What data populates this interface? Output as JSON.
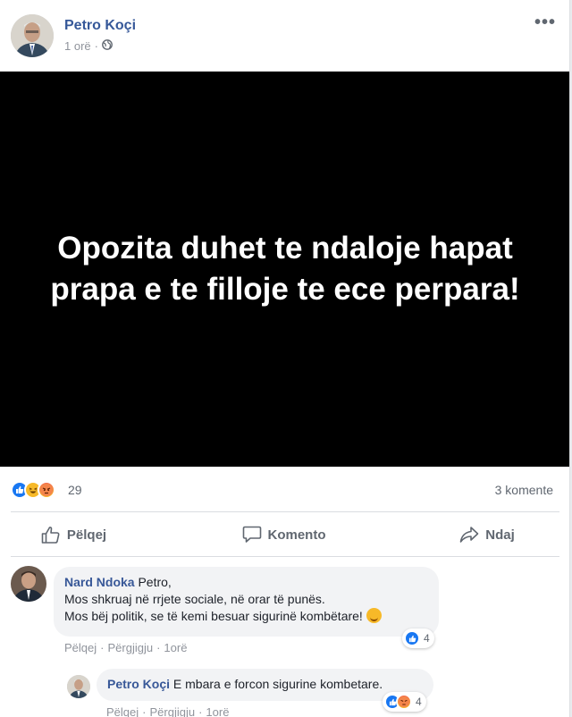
{
  "post": {
    "author": "Petro Koçi",
    "time": "1 orë",
    "separator": "·",
    "more_icon": "more-horizontal-icon",
    "privacy_icon": "globe-icon",
    "image_text": "Opozita duhet te ndaloje hapat prapa e te filloje te ece perpara!"
  },
  "stats": {
    "reactions": [
      "like",
      "haha",
      "angry"
    ],
    "reaction_count": "29",
    "comment_count": "3 komente"
  },
  "actions": [
    {
      "label": "Pëlqej",
      "icon": "thumbs-up-icon"
    },
    {
      "label": "Komento",
      "icon": "comment-icon"
    },
    {
      "label": "Ndaj",
      "icon": "share-icon"
    }
  ],
  "comments": [
    {
      "author": "Nard Ndoka",
      "lines": [
        "Petro,",
        "Mos shkruaj në rrjete sociale, në orar të punës.",
        "Mos bëj politik, se të kemi besuar sigurinë kombëtare!"
      ],
      "like": "Pëlqej",
      "reply": "Përgjigju",
      "time": "1orë",
      "reaction_count": "4",
      "reactions": [
        "like"
      ]
    },
    {
      "author": "Petro Koçi",
      "text": "E mbara e forcon sigurine kombetare.",
      "like": "Pëlqej",
      "reply": "Përgjigju",
      "time": "1orë",
      "reaction_count": "4",
      "reactions": [
        "like",
        "angry"
      ]
    }
  ],
  "colors": {
    "link": "#365899",
    "accent": "#1877f2",
    "muted": "#90949c"
  }
}
